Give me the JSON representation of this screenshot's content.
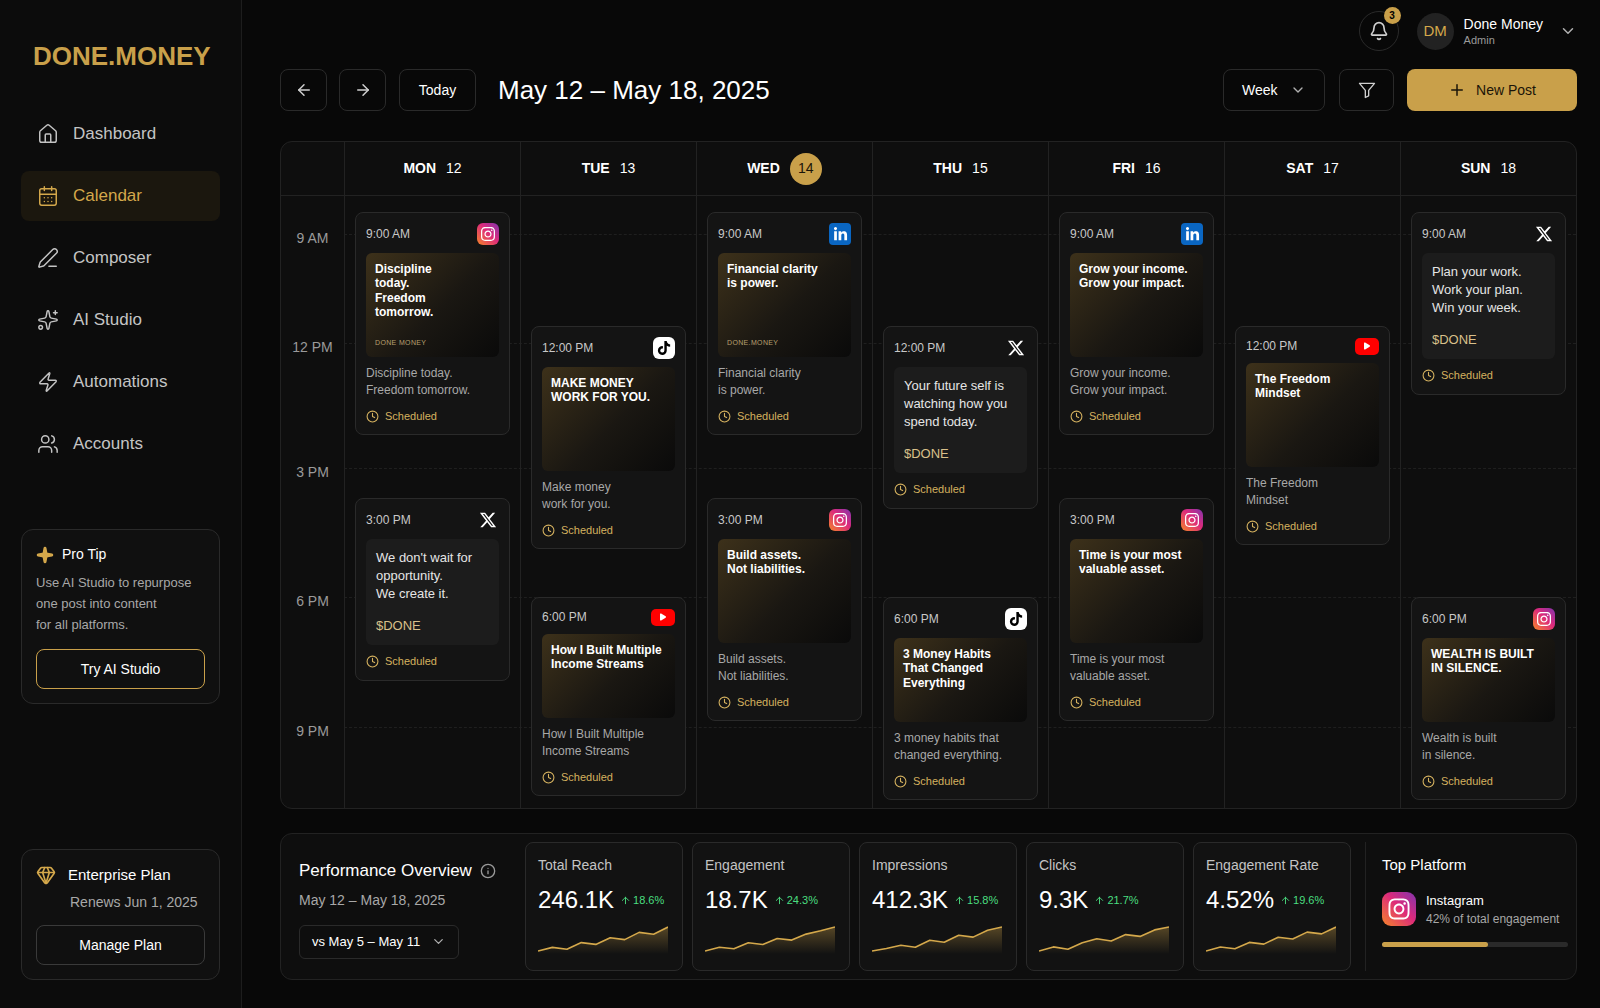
{
  "sidebar": {
    "logo": "DONE.MONEY",
    "items": [
      {
        "label": "Dashboard",
        "selected": false
      },
      {
        "label": "Calendar",
        "selected": true
      },
      {
        "label": "Composer",
        "selected": false
      },
      {
        "label": "AI Studio",
        "selected": false
      },
      {
        "label": "Automations",
        "selected": false
      },
      {
        "label": "Accounts",
        "selected": false
      }
    ],
    "pro_tip": {
      "title": "Pro Tip",
      "text": "Use AI Studio to repurpose\none post into content\nfor all platforms.",
      "button": "Try AI Studio"
    },
    "plan": {
      "title": "Enterprise Plan",
      "renews": "Renews Jun 1, 2025",
      "button": "Manage Plan"
    }
  },
  "topbar": {
    "notifications": "3",
    "user": {
      "initials": "DM",
      "name": "Done Money",
      "role": "Admin"
    }
  },
  "toolbar": {
    "today": "Today",
    "range": "May 12 – May 18, 2025",
    "view": "Week",
    "new_post": "New Post"
  },
  "calendar": {
    "time_labels": [
      "9 AM",
      "12 PM",
      "3 PM",
      "6 PM",
      "9 PM"
    ],
    "days": [
      {
        "name": "MON",
        "date": "12",
        "selected": false,
        "posts": [
          {
            "time": "9:00 AM",
            "platform": "instagram",
            "kind": "image",
            "image_text": "Discipline\ntoday.\nFreedom\ntomorrow.",
            "watermark": "DONE MONEY",
            "caption": "Discipline today.\nFreedom tomorrow.",
            "status": "Scheduled"
          },
          {
            "time": "3:00 PM",
            "platform": "x",
            "kind": "text",
            "text": "We don't wait for\nopportunity.\nWe create it.",
            "tag": "$DONE",
            "status": "Scheduled"
          }
        ]
      },
      {
        "name": "TUE",
        "date": "13",
        "selected": false,
        "posts": [
          {
            "time": "12:00 PM",
            "platform": "tiktok",
            "kind": "image",
            "image_text": "MAKE MONEY\nWORK FOR YOU.",
            "caption": "Make money\nwork for you.",
            "status": "Scheduled"
          },
          {
            "time": "6:00 PM",
            "platform": "youtube",
            "kind": "image",
            "image_text": "How I Built Multiple\nIncome Streams",
            "caption": "How I Built Multiple\nIncome Streams",
            "status": "Scheduled"
          }
        ]
      },
      {
        "name": "WED",
        "date": "14",
        "selected": true,
        "posts": [
          {
            "time": "9:00 AM",
            "platform": "linkedin",
            "kind": "image",
            "image_text": "Financial clarity\nis power.",
            "watermark": "DONE.MONEY",
            "caption": "Financial clarity\nis power.",
            "status": "Scheduled"
          },
          {
            "time": "3:00 PM",
            "platform": "instagram",
            "kind": "image",
            "image_text": "Build assets.\nNot liabilities.",
            "caption": "Build assets.\nNot liabilities.",
            "status": "Scheduled"
          }
        ]
      },
      {
        "name": "THU",
        "date": "15",
        "selected": false,
        "posts": [
          {
            "time": "12:00 PM",
            "platform": "x",
            "kind": "text",
            "text": "Your future self is\nwatching how you\nspend today.",
            "tag": "$DONE",
            "status": "Scheduled"
          },
          {
            "time": "6:00 PM",
            "platform": "tiktok",
            "kind": "image",
            "image_text": "3 Money Habits\nThat Changed\nEverything",
            "caption": "3 money habits that\nchanged everything.",
            "status": "Scheduled"
          }
        ]
      },
      {
        "name": "FRI",
        "date": "16",
        "selected": false,
        "posts": [
          {
            "time": "9:00 AM",
            "platform": "linkedin",
            "kind": "image",
            "image_text": "Grow your income.\nGrow your impact.",
            "caption": "Grow your income.\nGrow your impact.",
            "status": "Scheduled"
          },
          {
            "time": "3:00 PM",
            "platform": "instagram",
            "kind": "image",
            "image_text": "Time is your most\nvaluable asset.",
            "caption": "Time is your most\nvaluable asset.",
            "status": "Scheduled"
          }
        ]
      },
      {
        "name": "SAT",
        "date": "17",
        "selected": false,
        "posts": [
          {
            "time": "12:00 PM",
            "platform": "youtube",
            "kind": "image",
            "image_text": "The Freedom\nMindset",
            "caption": "The Freedom\nMindset",
            "status": "Scheduled"
          }
        ]
      },
      {
        "name": "SUN",
        "date": "18",
        "selected": false,
        "posts": [
          {
            "time": "9:00 AM",
            "platform": "x",
            "kind": "text",
            "text": "Plan your work.\nWork your plan.\nWin your week.",
            "tag": "$DONE",
            "status": "Scheduled"
          },
          {
            "time": "6:00 PM",
            "platform": "instagram",
            "kind": "image",
            "image_text": "WEALTH IS BUILT\nIN SILENCE.",
            "caption": "Wealth is built\nin silence.",
            "status": "Scheduled"
          }
        ]
      }
    ]
  },
  "performance": {
    "title": "Performance Overview",
    "range": "May 12 – May 18, 2025",
    "compare": "vs May 5 – May 11",
    "metrics": [
      {
        "label": "Total Reach",
        "value": "246.1K",
        "change": "18.6%",
        "trend": [
          3,
          3.6,
          3.3,
          4.4,
          4.1,
          5.2,
          4.9,
          6.1,
          5.8,
          7
        ]
      },
      {
        "label": "Engagement",
        "value": "18.7K",
        "change": "24.3%",
        "trend": [
          2.5,
          3.2,
          2.9,
          4,
          3.7,
          4.8,
          4.5,
          5.6,
          6.2,
          6.9
        ]
      },
      {
        "label": "Impressions",
        "value": "412.3K",
        "change": "15.8%",
        "trend": [
          3,
          3.4,
          3.9,
          3.6,
          4.7,
          4.4,
          5.5,
          5.2,
          6.3,
          6.8
        ]
      },
      {
        "label": "Clicks",
        "value": "9.3K",
        "change": "21.7%",
        "trend": [
          2.8,
          3.5,
          3.1,
          4.2,
          4.9,
          4.5,
          5.6,
          5.3,
          6.4,
          6.9
        ]
      },
      {
        "label": "Engagement Rate",
        "value": "4.52%",
        "change": "19.6%",
        "trend": [
          2.6,
          3.3,
          3,
          4.1,
          3.8,
          5,
          4.7,
          5.9,
          5.6,
          6.8
        ]
      }
    ],
    "top_platform": {
      "title": "Top Platform",
      "name": "Instagram",
      "share": "42% of total engagement",
      "level": 0.57
    }
  }
}
